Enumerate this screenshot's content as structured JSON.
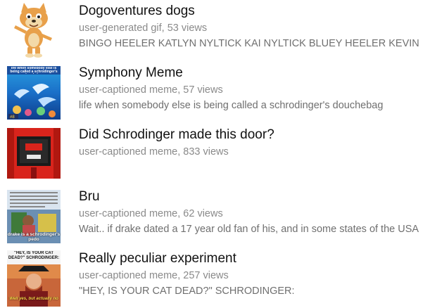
{
  "items": [
    {
      "title": "Dogoventures dogs",
      "meta": "user-generated gif, 53 views",
      "description": "BINGO HEELER KATLYN NYLTICK KAI NYLTICK BLUEY HEELER KEVIN",
      "thumb": "bingo-heeler-dog-thumbnail"
    },
    {
      "title": "Symphony Meme",
      "meta": "user-captioned meme, 57 views",
      "description": "life when somebody else is being called a schrodinger's douchebag",
      "thumb": "ocean-dolphins-meme-thumbnail",
      "thumb_caption": "life when somebody else is being called a schrodinger's douchebag"
    },
    {
      "title": "Did Schrodinger made this door?",
      "meta": "user-captioned meme, 833 views",
      "description": "",
      "thumb": "red-door-thumbnail"
    },
    {
      "title": "Bru",
      "meta": "user-captioned meme, 62 views",
      "description": "Wait.. if drake dated a 17 year old fan of his, and in some states of the USA",
      "thumb": "drake-schrodinger-meme-thumbnail",
      "thumb_caption_bottom": "drake is a schrodinger's pedo"
    },
    {
      "title": "Really peculiar experiment",
      "meta": "user-captioned meme, 257 views",
      "description": "\"HEY, IS YOUR CAT DEAD?\" SCHRODINGER:",
      "thumb": "pirate-cat-meme-thumbnail",
      "thumb_caption_top": "\"HEY, IS YOUR CAT DEAD?\" SCHRODINGER:",
      "thumb_caption_bottom": "Well yes, but actually no"
    }
  ],
  "colors": {
    "title": "#111111",
    "meta": "#8a8a8a",
    "description": "#6f6f6f",
    "bingo_orange": "#e8a04a",
    "door_red": "#d9241c"
  }
}
